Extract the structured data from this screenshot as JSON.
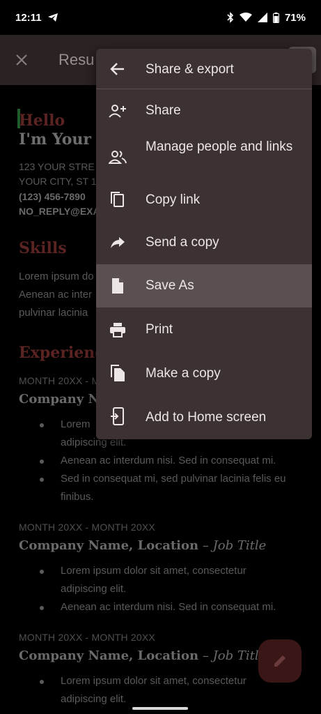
{
  "status_bar": {
    "time": "12:11",
    "battery": "71%"
  },
  "app_bar": {
    "title": "Resu"
  },
  "document": {
    "hello": "Hello",
    "name": "I'm Your N",
    "address1": "123 YOUR STRE",
    "address2": "YOUR CITY, ST 1",
    "phone": "(123) 456-7890",
    "email": "NO_REPLY@EXA",
    "skills_heading": "Skills",
    "skills_lines": [
      "Lorem ipsum do",
      "Aenean ac inter",
      "pulvinar lacinia"
    ],
    "experience_heading": "Experience",
    "jobs": [
      {
        "date": "MONTH 20XX - M",
        "company": "Company Nar",
        "job_title": "",
        "bullets": [
          [
            "Lorem",
            "adipiscing elit."
          ],
          [
            "Aenean ac interdum nisi. Sed in consequat mi."
          ],
          [
            "Sed in consequat mi, sed pulvinar lacinia felis eu",
            "finibus."
          ]
        ]
      },
      {
        "date": "MONTH 20XX - MONTH 20XX",
        "company": "Company Name, Location",
        "job_title": "Job Title",
        "bullets": [
          [
            "Lorem ipsum dolor sit amet, consectetur",
            "adipiscing elit."
          ],
          [
            "Aenean ac interdum nisi. Sed in consequat mi."
          ]
        ]
      },
      {
        "date": "MONTH 20XX - MONTH 20XX",
        "company": "Company Name, Location",
        "job_title": "Job Title",
        "bullets": [
          [
            "Lorem ipsum dolor sit amet, consectetur",
            "adipiscing elit."
          ]
        ]
      }
    ],
    "dash": " – "
  },
  "menu": {
    "header": "Share & export",
    "items": [
      {
        "label": "Share",
        "icon": "person-add-icon"
      },
      {
        "label": "Manage people and links",
        "icon": "people-icon"
      },
      {
        "label": "Copy link",
        "icon": "copy-icon"
      },
      {
        "label": "Send a copy",
        "icon": "forward-arrow-icon"
      },
      {
        "label": "Save As",
        "icon": "file-icon",
        "selected": true
      },
      {
        "label": "Print",
        "icon": "print-icon"
      },
      {
        "label": "Make a copy",
        "icon": "duplicate-icon"
      },
      {
        "label": "Add to Home screen",
        "icon": "add-to-home-icon"
      }
    ]
  },
  "colors": {
    "menu_bg": "#3d3232",
    "menu_selected": "#5a5050",
    "heading_red": "#5c2323",
    "fab_bg": "#3a1616"
  }
}
